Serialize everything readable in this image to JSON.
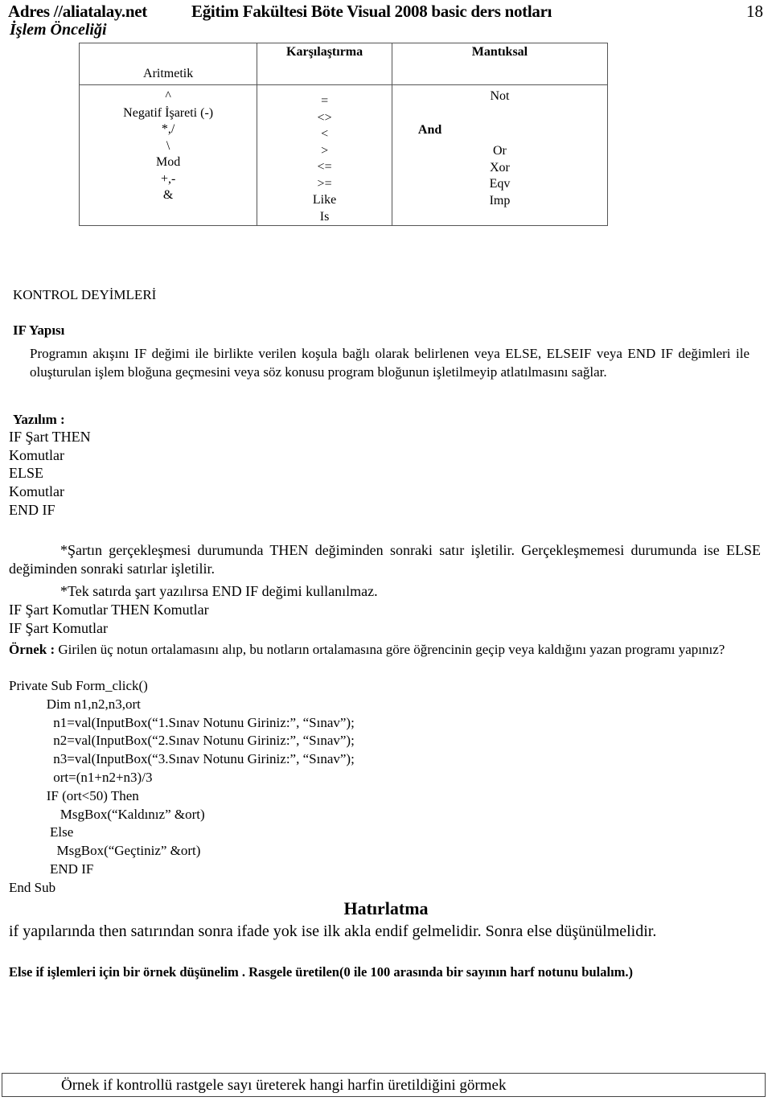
{
  "header": {
    "site": "Adres //aliatalay.net",
    "course": "Eğitim Fakültesi Böte Visual 2008 basic ders notları",
    "page_number": "18"
  },
  "subtitle": "İşlem Önceliği",
  "precedence_table": {
    "headers": [
      "Aritmetik",
      "Karşılaştırma",
      "Mantıksal"
    ],
    "arithmetic": [
      "^",
      "Negatif İşareti (-)",
      "*,/",
      "\\",
      "Mod",
      "+,-",
      "&"
    ],
    "comparison": [
      "=",
      "<>",
      "<",
      ">",
      "<=",
      ">=",
      "Like",
      "Is"
    ],
    "logical": {
      "not": "Not",
      "and": "And",
      "rest": [
        "Or",
        "Xor",
        "Eqv",
        "Imp"
      ]
    }
  },
  "section_title": "KONTROL DEYİMLERİ",
  "if_title": "IF Yapısı",
  "if_description": "Programın akışını IF değimi ile birlikte verilen koşula bağlı olarak belirlenen veya ELSE, ELSEIF veya END IF değimleri ile oluşturulan  işlem bloğuna geçmesini veya söz konusu program bloğunun işletilmeyip atlatılmasını sağlar.",
  "syntax_label": "Yazılım :",
  "syntax_lines": [
    "IF Şart THEN",
    "Komutlar",
    "ELSE",
    "Komutlar",
    "END IF"
  ],
  "note1": "*Şartın gerçekleşmesi durumunda THEN değiminden sonraki satır işletilir. Gerçekleşmemesi durumunda ise ELSE değiminden sonraki satırlar işletilir.",
  "note2": "*Tek satırda şart yazılırsa  END IF değimi kullanılmaz.",
  "single_line_forms": [
    "IF Şart Komutlar THEN Komutlar",
    "IF Şart Komutlar"
  ],
  "example": {
    "label": "Örnek :",
    "text": "  Girilen üç notun ortalamasını alıp, bu notların ortalamasına göre öğrencinin geçip veya kaldığını yazan programı yapınız?"
  },
  "code_lines": [
    "Private Sub Form_click()",
    "           Dim n1,n2,n3,ort",
    "             n1=val(InputBox(“1.Sınav Notunu Giriniz:”, “Sınav”);",
    "             n2=val(InputBox(“2.Sınav Notunu Giriniz:”, “Sınav”);",
    "             n3=val(InputBox(“3.Sınav Notunu Giriniz:”, “Sınav”);",
    "             ort=(n1+n2+n3)/3",
    "           IF (ort<50) Then",
    "               MsgBox(“Kaldınız” &ort)",
    "            Else",
    "              MsgBox(“Geçtiniz” &ort)",
    "            END IF",
    "End Sub"
  ],
  "reminder_title": "Hatırlatma",
  "reminder_text": "if yapılarında then satırından sonra ifade yok ise ilk akla endif gelmelidir. Sonra else düşünülmelidir.",
  "elseif_text": "Else if işlemleri için bir örnek düşünelim . Rasgele üretilen(0 ile 100 arasında bir sayının harf notunu bulalım.)",
  "boxed_example": "Örnek if kontrollü rastgele sayı üreterek hangi harfin üretildiğini görmek"
}
